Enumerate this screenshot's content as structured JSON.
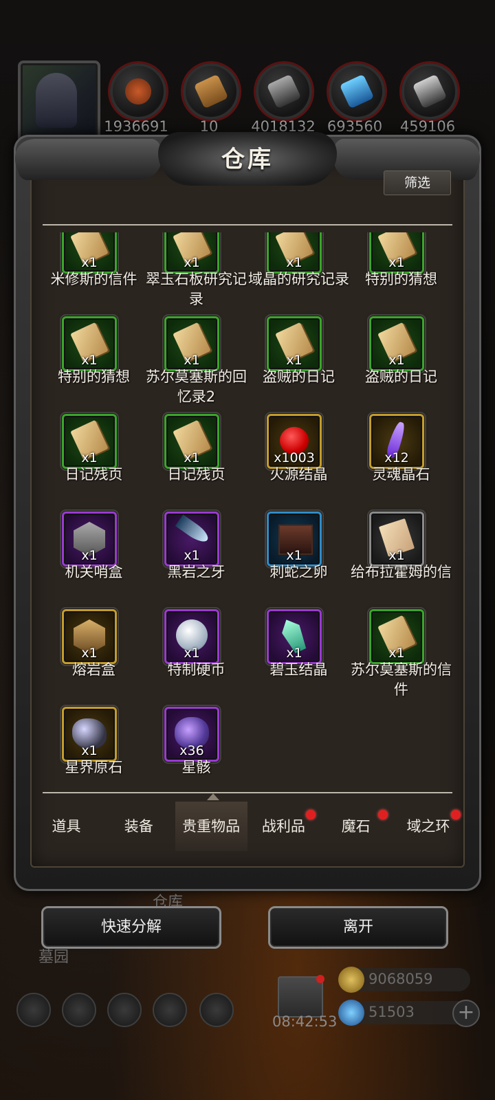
{
  "resources": [
    {
      "icon": "portrait-avatar",
      "value": ""
    },
    {
      "icon": "meat-icon",
      "value": "1936691"
    },
    {
      "icon": "wood-icon",
      "value": "10"
    },
    {
      "icon": "iron-icon",
      "value": "4018132"
    },
    {
      "icon": "crystal-icon",
      "value": "693560"
    },
    {
      "icon": "steel-icon",
      "value": "459106"
    }
  ],
  "panel": {
    "title": "仓库",
    "filter_label": "筛选"
  },
  "items": [
    {
      "name": "米修斯的信件",
      "qty": "x1",
      "rarity": "green",
      "art": "scroll"
    },
    {
      "name": "翠玉石板研究记录",
      "qty": "x1",
      "rarity": "green",
      "art": "scroll"
    },
    {
      "name": "域晶的研究记录",
      "qty": "x1",
      "rarity": "green",
      "art": "scroll"
    },
    {
      "name": "特别的猜想",
      "qty": "x1",
      "rarity": "green",
      "art": "scroll"
    },
    {
      "name": "特别的猜想",
      "qty": "x1",
      "rarity": "green",
      "art": "scroll"
    },
    {
      "name": "苏尔莫塞斯的回忆录2",
      "qty": "x1",
      "rarity": "green",
      "art": "scroll"
    },
    {
      "name": "盗贼的日记",
      "qty": "x1",
      "rarity": "green",
      "art": "scroll"
    },
    {
      "name": "盗贼的日记",
      "qty": "x1",
      "rarity": "green",
      "art": "scroll"
    },
    {
      "name": "日记残页",
      "qty": "x1",
      "rarity": "green",
      "art": "scroll"
    },
    {
      "name": "日记残页",
      "qty": "x1",
      "rarity": "green",
      "art": "scroll"
    },
    {
      "name": "火源结晶",
      "qty": "x1003",
      "rarity": "gold",
      "art": "ruby"
    },
    {
      "name": "灵魂晶石",
      "qty": "x12",
      "rarity": "gold",
      "art": "shard"
    },
    {
      "name": "机关哨盒",
      "qty": "x1",
      "rarity": "purple",
      "art": "hex"
    },
    {
      "name": "黑岩之牙",
      "qty": "x1",
      "rarity": "purple",
      "art": "fang"
    },
    {
      "name": "刺蛇之卵",
      "qty": "x1",
      "rarity": "blue",
      "art": "cube"
    },
    {
      "name": "给布拉霍姆的信",
      "qty": "x1",
      "rarity": "gray",
      "art": "letter"
    },
    {
      "name": "熔岩盒",
      "qty": "x1",
      "rarity": "gold",
      "art": "hex lava"
    },
    {
      "name": "特制硬币",
      "qty": "x1",
      "rarity": "purple",
      "art": "coin"
    },
    {
      "name": "碧玉结晶",
      "qty": "x1",
      "rarity": "purple",
      "art": "jade"
    },
    {
      "name": "苏尔莫塞斯的信件",
      "qty": "x1",
      "rarity": "green",
      "art": "scroll"
    },
    {
      "name": "星界原石",
      "qty": "x1",
      "rarity": "gold",
      "art": "ore"
    },
    {
      "name": "星骸",
      "qty": "x36",
      "rarity": "purple",
      "art": "stardust"
    }
  ],
  "tabs": [
    {
      "label": "道具",
      "dot": false,
      "active": false
    },
    {
      "label": "装备",
      "dot": false,
      "active": false
    },
    {
      "label": "贵重物品",
      "dot": false,
      "active": true
    },
    {
      "label": "战利品",
      "dot": true,
      "active": false
    },
    {
      "label": "魔石",
      "dot": true,
      "active": false
    },
    {
      "label": "域之环",
      "dot": true,
      "active": false
    }
  ],
  "buttons": {
    "quick_decompose": "快速分解",
    "leave": "离开"
  },
  "background": {
    "warehouse_label": "仓库",
    "graveyard_label": "墓园",
    "clock": "08:42:53",
    "gold": "9068059",
    "diamonds": "51503"
  },
  "colors": {
    "green": "#3aa52a",
    "gold": "#c49d2a",
    "purple": "#9a3ad0",
    "blue": "#2f8cc8",
    "badge": "#e02020"
  }
}
